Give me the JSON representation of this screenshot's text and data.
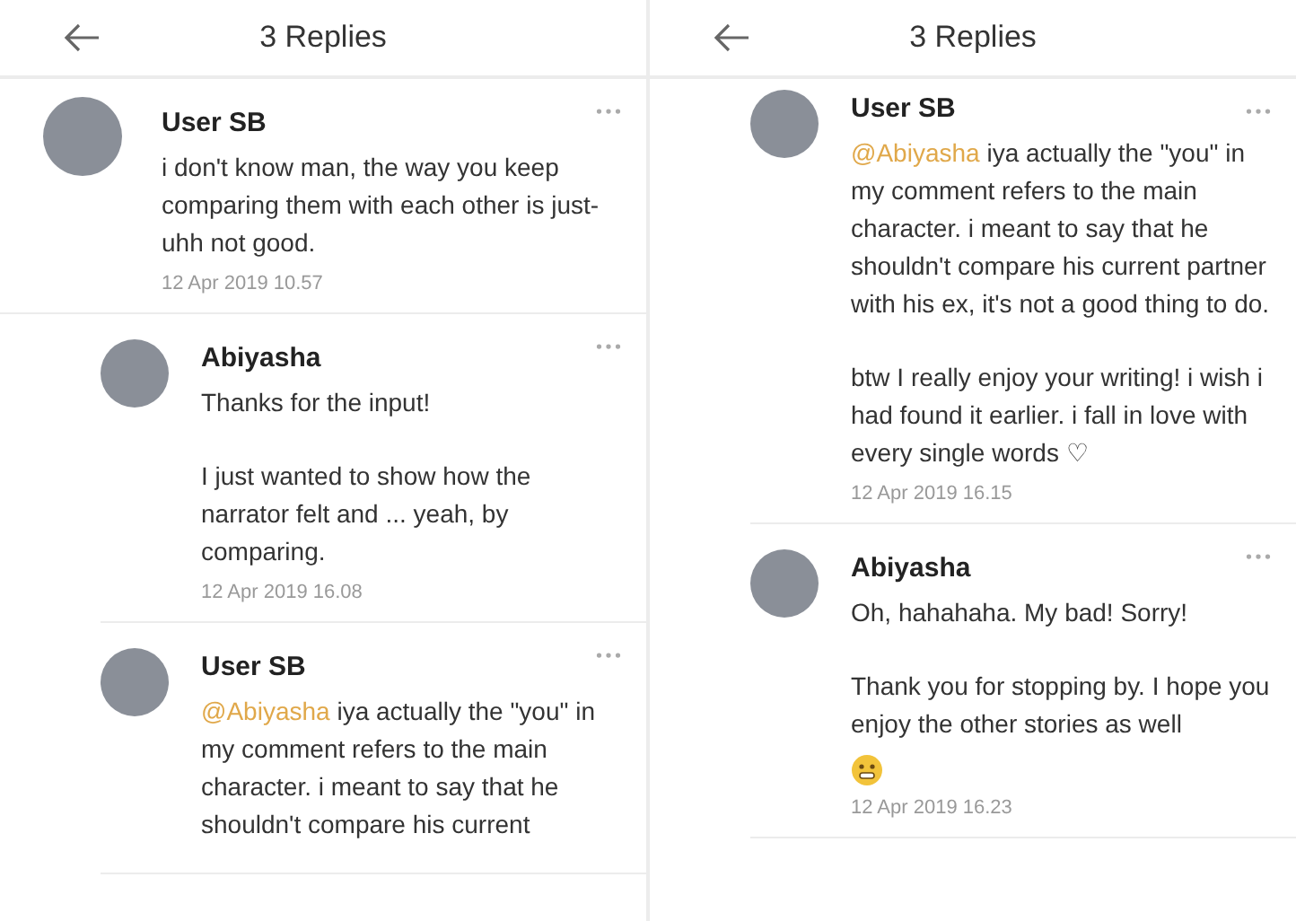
{
  "panels": [
    {
      "header": {
        "title": "3 Replies"
      },
      "comments": [
        {
          "kind": "top",
          "author": "User SB",
          "body": [
            {
              "kind": "text",
              "text": "i don't know man, the way you keep comparing them with each other is just-uhh not good."
            }
          ],
          "date": "12 Apr 2019 10.57"
        },
        {
          "kind": "reply",
          "author": "Abiyasha",
          "body": [
            {
              "kind": "text",
              "text": "Thanks for the input!"
            },
            {
              "kind": "text",
              "text": "I just wanted to show how the narrator felt and ... yeah, by comparing."
            }
          ],
          "date": "12 Apr 2019 16.08"
        },
        {
          "kind": "reply",
          "author": "User SB",
          "body": [
            {
              "kind": "text",
              "mention": "@Abiyasha",
              "text": "iya actually the \"you\" in my comment refers to the main character. i meant to say that he shouldn't compare his current"
            }
          ]
        }
      ]
    },
    {
      "header": {
        "title": "3 Replies"
      },
      "comments": [
        {
          "kind": "reply",
          "author": "User SB",
          "body": [
            {
              "kind": "text",
              "mention": "@Abiyasha",
              "text": "iya actually the \"you\" in my comment refers to the main character. i meant to say that he shouldn't compare his current partner with his ex, it's not a good thing to do."
            },
            {
              "kind": "text",
              "text": "btw I really enjoy your writing! i wish i had found it earlier. i fall in love with every single words ♡"
            }
          ],
          "date": "12 Apr 2019 16.15"
        },
        {
          "kind": "reply",
          "author": "Abiyasha",
          "body": [
            {
              "kind": "text",
              "text": "Oh, hahahaha. My bad! Sorry!"
            },
            {
              "kind": "text",
              "text": "Thank you for stopping by. I hope you enjoy the other stories as well"
            },
            {
              "kind": "emoji"
            }
          ],
          "date": "12 Apr 2019 16.23"
        }
      ]
    }
  ]
}
